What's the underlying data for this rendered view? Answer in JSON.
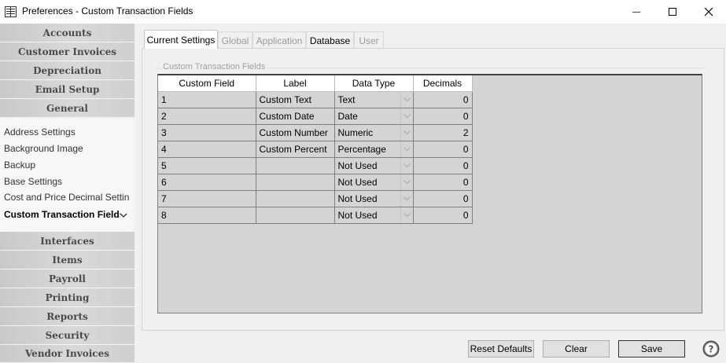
{
  "window": {
    "title": "Preferences - Custom Transaction Fields",
    "icons": [
      "app-icon",
      "minimize-icon",
      "maximize-icon",
      "close-icon"
    ]
  },
  "sidebar": {
    "top_sections": [
      "Accounts",
      "Customer Invoices",
      "Depreciation",
      "Email Setup",
      "General"
    ],
    "general_items": [
      "Address Settings",
      "Background Image",
      "Backup",
      "Base Settings",
      "Cost and Price Decimal Settin...",
      "Custom Transaction Fields"
    ],
    "active_item": "Custom Transaction Fields",
    "bottom_sections": [
      "Interfaces",
      "Items",
      "Payroll",
      "Printing",
      "Reports",
      "Security",
      "Vendor Invoices"
    ]
  },
  "tabs": [
    {
      "label": "Current Settings",
      "state": "active"
    },
    {
      "label": "Global",
      "state": "disabled"
    },
    {
      "label": "Application",
      "state": "disabled"
    },
    {
      "label": "Database",
      "state": "enabled"
    },
    {
      "label": "User",
      "state": "disabled"
    }
  ],
  "group": {
    "title": "Custom Transaction Fields"
  },
  "grid": {
    "headers": [
      "Custom Field",
      "Label",
      "Data Type",
      "Decimals"
    ],
    "rows": [
      {
        "field": "1",
        "label": "Custom  Text",
        "type": "Text",
        "decimals": "0"
      },
      {
        "field": "2",
        "label": "Custom  Date",
        "type": "Date",
        "decimals": "0"
      },
      {
        "field": "3",
        "label": "Custom Number",
        "type": "Numeric",
        "decimals": "2"
      },
      {
        "field": "4",
        "label": "Custom Percent",
        "type": "Percentage",
        "decimals": "0"
      },
      {
        "field": "5",
        "label": "",
        "type": "Not Used",
        "decimals": "0"
      },
      {
        "field": "6",
        "label": "",
        "type": "Not Used",
        "decimals": "0"
      },
      {
        "field": "7",
        "label": "",
        "type": "Not Used",
        "decimals": "0"
      },
      {
        "field": "8",
        "label": "",
        "type": "Not Used",
        "decimals": "0"
      }
    ]
  },
  "buttons": {
    "reset_defaults": "Reset Defaults",
    "clear": "Clear",
    "save": "Save"
  },
  "colors": {
    "sidebar_header": "#d0d0d0",
    "grid_background": "#d4d4d4"
  }
}
